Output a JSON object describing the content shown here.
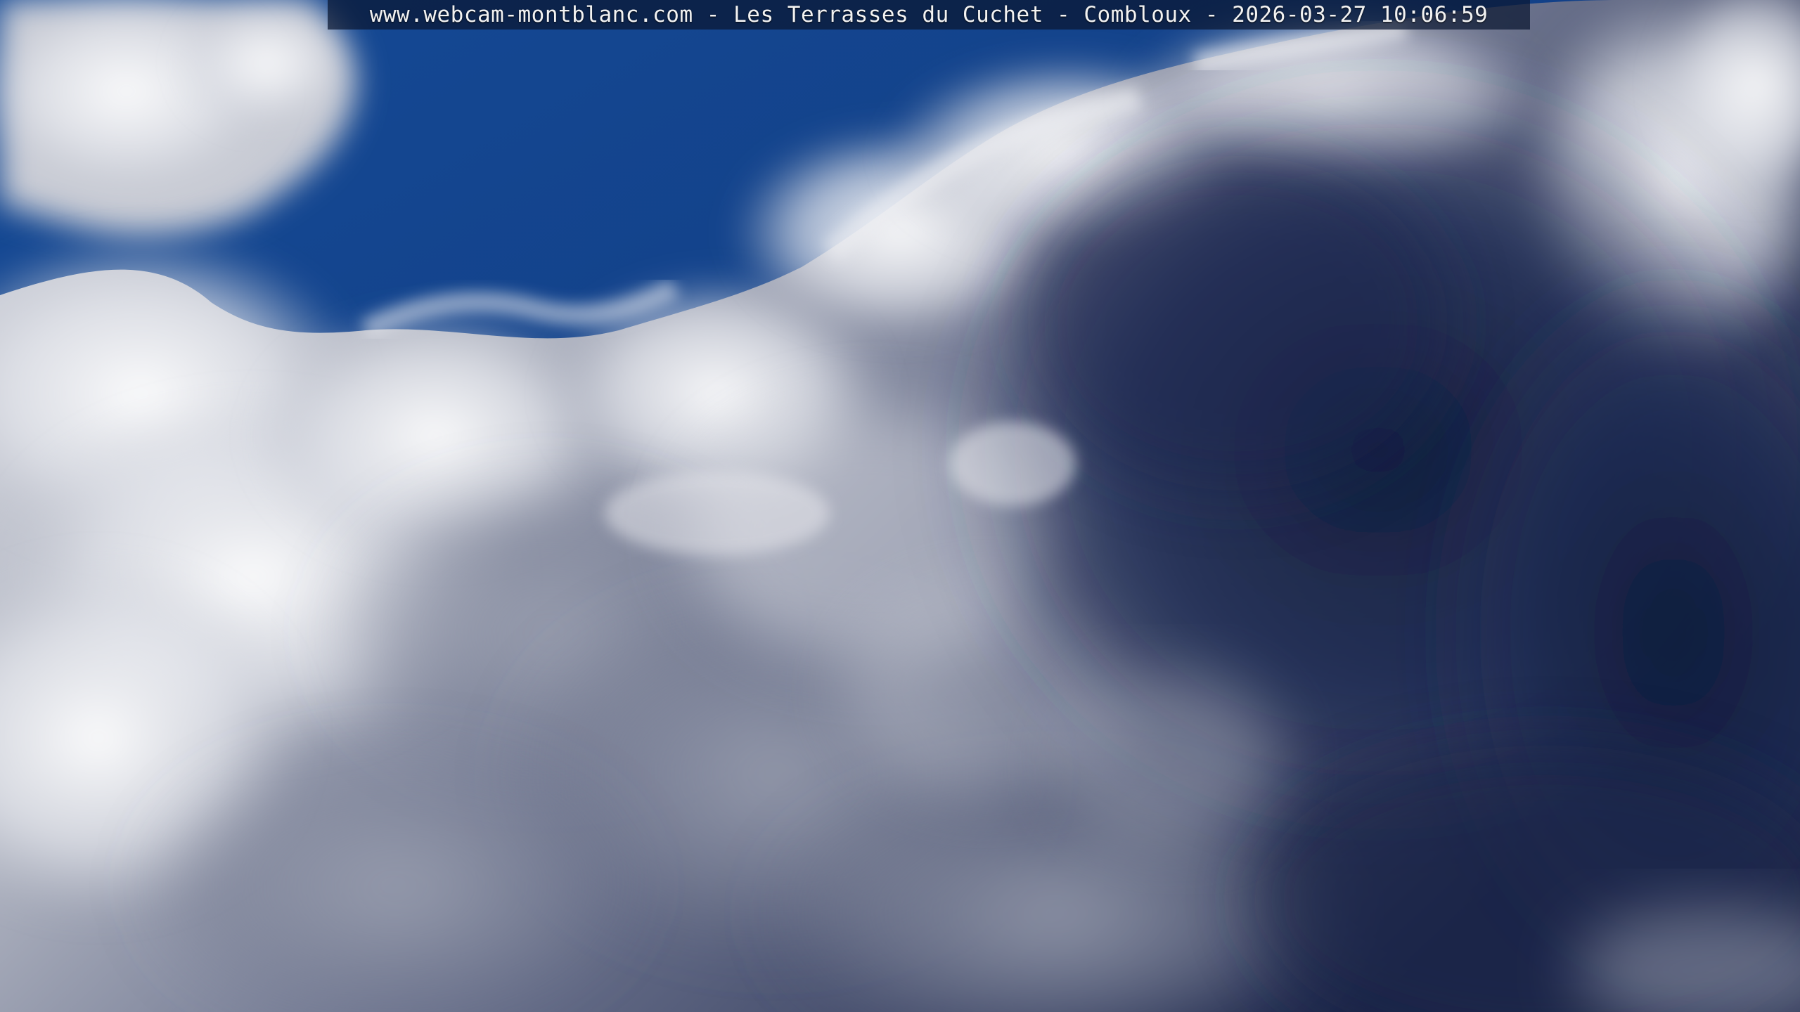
{
  "overlay": {
    "caption": "www.webcam-montblanc.com - Les Terrasses du Cuchet - Combloux - 2026-03-27 10:06:59"
  },
  "colors": {
    "sky_blue": "#123f86",
    "sky_deep": "#0d2f6e",
    "cloud_bright": "#f4f4f6",
    "cloud_mid": "#b9bcc6",
    "cloud_shadow": "#3a4262",
    "storm_dark": "#101a3c"
  }
}
